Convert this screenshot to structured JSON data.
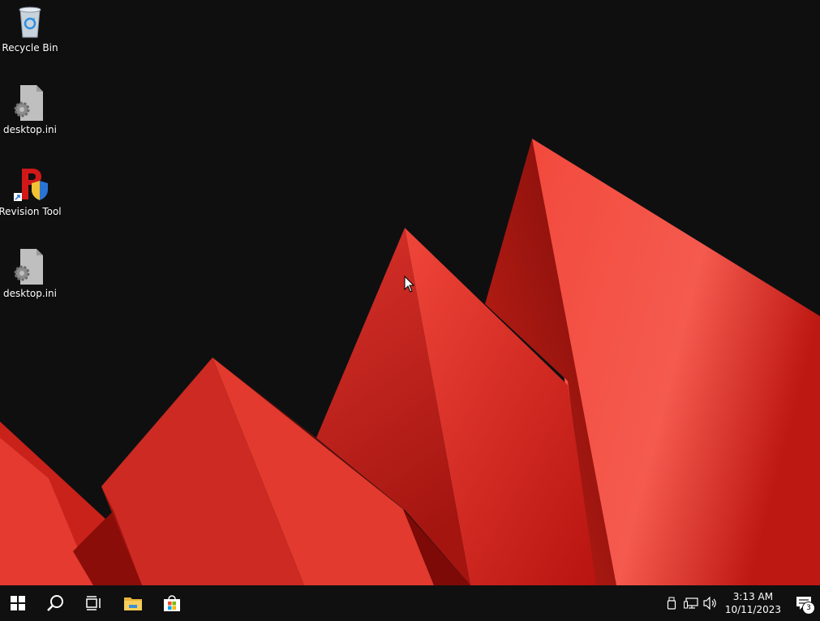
{
  "desktop": {
    "icons": [
      {
        "label": "Recycle Bin",
        "icon": "recycle-bin-icon"
      },
      {
        "label": "desktop.ini",
        "icon": "settings-file-icon"
      },
      {
        "label": "Revision Tool",
        "icon": "revision-tool-icon"
      },
      {
        "label": "desktop.ini",
        "icon": "settings-file-icon"
      }
    ]
  },
  "taskbar": {
    "buttons": [
      "windows-start-icon",
      "search-icon",
      "task-view-icon",
      "file-explorer-icon",
      "microsoft-store-icon"
    ],
    "tray": {
      "time": "3:13 AM",
      "date": "10/11/2023",
      "notification_count": "3"
    }
  },
  "colors": {
    "wallpaper_bg": "#0f0f10",
    "accent_red": "#e8352a",
    "taskbar_bg": "#101010"
  }
}
